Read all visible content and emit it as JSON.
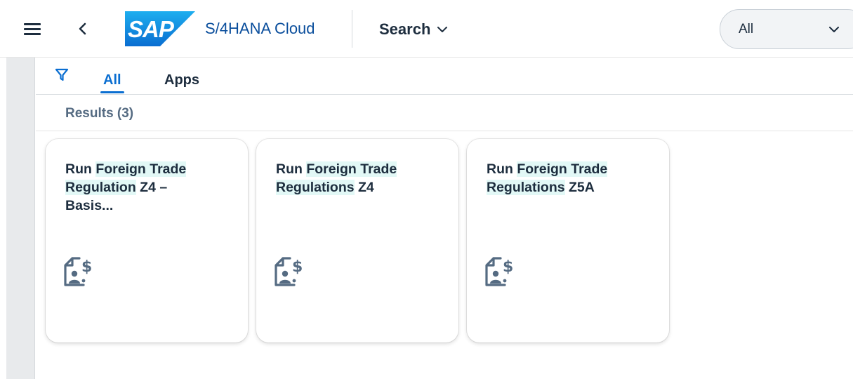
{
  "shell": {
    "logo_text": "SAP",
    "product_name": "S/4HANA Cloud",
    "search_menu_label": "Search",
    "scope_value": "All"
  },
  "tabs": [
    {
      "label": "All",
      "active": true
    },
    {
      "label": "Apps",
      "active": false
    }
  ],
  "results": {
    "title": "Results (3)"
  },
  "tiles": [
    {
      "title_parts": [
        "Run ",
        "Foreign",
        " ",
        "Trade",
        " ",
        "Regulation",
        " Z4 –",
        " Basis..."
      ],
      "icon": "customs-dollar-document-icon"
    },
    {
      "title_parts": [
        "Run ",
        "Foreign",
        " ",
        "Trade",
        " ",
        "Regulations",
        " Z4"
      ],
      "icon": "customs-dollar-document-icon"
    },
    {
      "title_parts": [
        "Run ",
        "Foreign",
        " ",
        "Trade",
        " ",
        "Regulations",
        " Z5A"
      ],
      "icon": "customs-dollar-document-icon"
    }
  ],
  "colors": {
    "brand_blue": "#0a6ed1",
    "product_blue": "#0a4e9c",
    "highlight": "#e2f8f6"
  }
}
